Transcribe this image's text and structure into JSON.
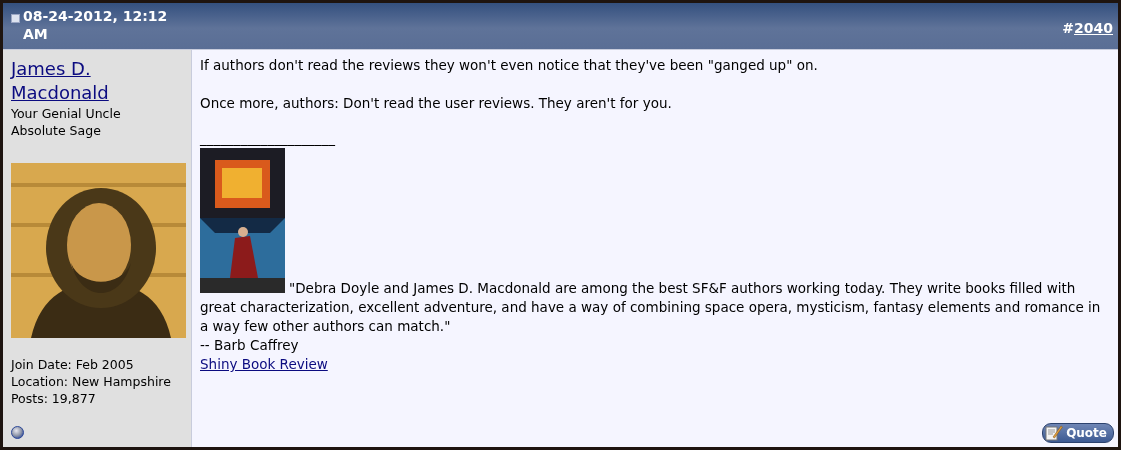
{
  "post": {
    "date": "08-24-2012, 12:12 AM",
    "number_prefix": "#",
    "number": "2040",
    "author": {
      "name": "James D. Macdonald",
      "title": "Your Genial Uncle",
      "rank": "Absolute Sage",
      "details": [
        "Join Date: Feb 2005",
        "Location: New Hampshire",
        "Posts: 19,877"
      ]
    },
    "message": [
      "If authors don't read the reviews they won't even notice that they've been \"ganged up\" on.",
      "Once more, authors: Don't read the user reviews. They aren't for you."
    ],
    "signature": {
      "rule": "____________________",
      "quote": "\"Debra Doyle and James D. Macdonald are among the best SF&F authors working today. They write books filled with great characterization, excellent adventure, and have a way of combining space opera, mysticism, fantasy elements and romance in a way few other authors can match.\"",
      "attribution": "-- Barb Caffrey",
      "link": "Shiny Book Review"
    },
    "buttons": [
      {
        "kind": "quote",
        "label": "Quote"
      }
    ]
  }
}
